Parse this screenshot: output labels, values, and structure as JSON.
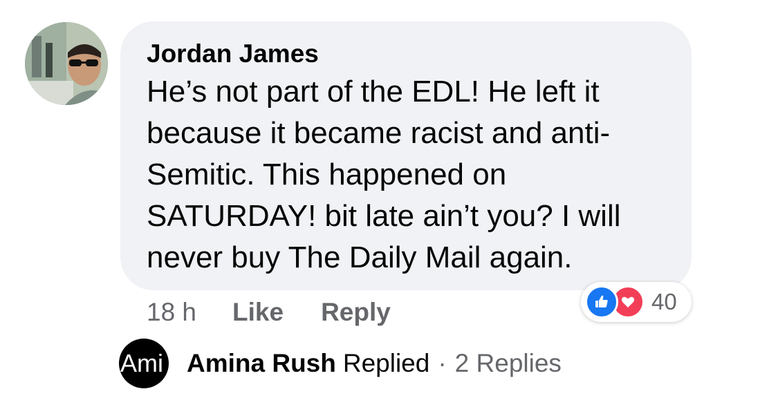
{
  "comment": {
    "author": "Jordan James",
    "text": "He’s not part of the EDL! He left it because it became racist and anti-Semitic. This happened on SATURDAY! bit late ain’t you? I will never buy The Daily Mail again.",
    "timestamp": "18 h",
    "like_label": "Like",
    "reply_label": "Reply",
    "reactions": {
      "icons": [
        "like-icon",
        "love-icon"
      ],
      "count": "40",
      "colors": {
        "like": "#1877f2",
        "love": "#f33e58"
      }
    }
  },
  "replies": {
    "avatar_text": "Ami",
    "name": "Amina Rush",
    "verb": "Replied",
    "separator": "·",
    "count_label": "2 Replies"
  },
  "colors": {
    "bubble": "#f0f2f5",
    "secondary_text": "#65676b"
  }
}
